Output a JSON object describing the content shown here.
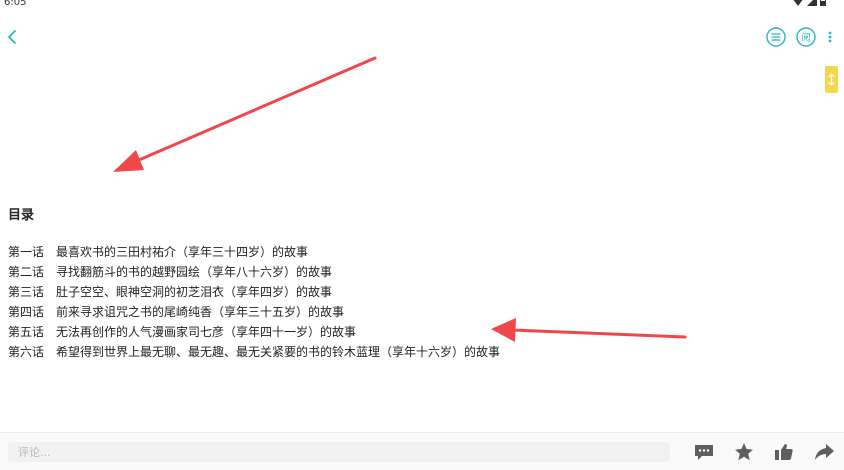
{
  "status_bar": {
    "time": "6:05"
  },
  "toc": {
    "title": "目录",
    "chapters": [
      {
        "num": "第一话",
        "title": "最喜欢书的三田村祐介（享年三十四岁）的故事"
      },
      {
        "num": "第二话",
        "title": "寻找翻筋斗的书的越野园绘（享年八十六岁）的故事"
      },
      {
        "num": "第三话",
        "title": "肚子空空、眼神空洞的初芝泪衣（享年四岁）的故事"
      },
      {
        "num": "第四话",
        "title": "前来寻求诅咒之书的尾崎纯香（享年三十五岁）的故事"
      },
      {
        "num": "第五话",
        "title": "无法再创作的人气漫画家司七彦（享年四十一岁）的故事"
      },
      {
        "num": "第六话",
        "title": "希望得到世界上最无聊、最无趣、最无关紧要的书的铃木蓝理（享年十六岁）的故事"
      }
    ]
  },
  "bottom_bar": {
    "comment_placeholder": "评论..."
  },
  "icons": {
    "back": "chevron-left-icon",
    "toc": "list-icon",
    "read": "read-mode-icon",
    "more": "more-vertical-icon",
    "side": "scroll-handle-icon",
    "comment": "comment-icon",
    "star": "star-icon",
    "like": "thumbs-up-icon",
    "share": "share-icon"
  },
  "colors": {
    "accent": "#2bb6c8",
    "side_tab": "#f6d64a",
    "annotation_arrow": "#f0484a",
    "bottom_icon": "#5f5f5f"
  }
}
